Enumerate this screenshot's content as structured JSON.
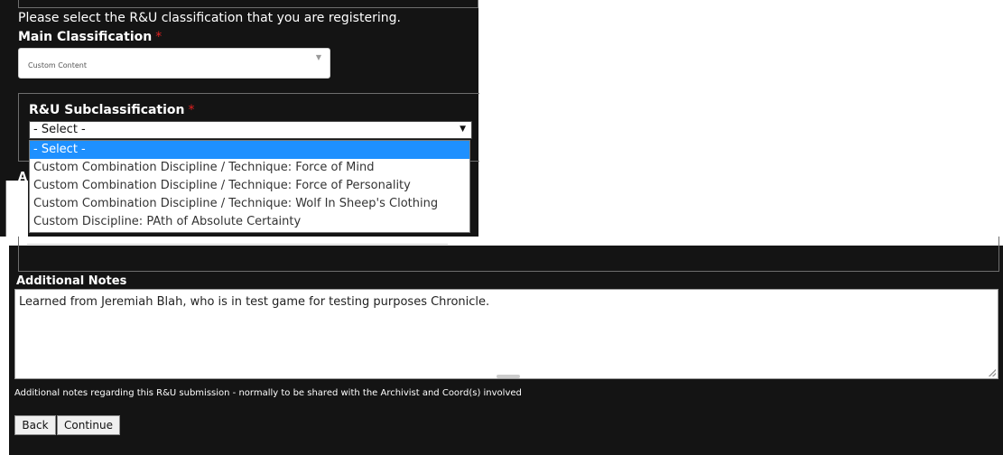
{
  "form": {
    "instructions": "Please select the R&U classification that you are registering.",
    "main_classification": {
      "label": "Main Classification",
      "required_marker": "*",
      "selected": "Custom Content"
    },
    "subclassification": {
      "label": "R&U Subclassification",
      "required_marker": "*",
      "selected": "- Select -",
      "options": [
        "- Select -",
        "Custom Combination Discipline / Technique: Force of Mind",
        "Custom Combination Discipline / Technique: Force of Personality",
        "Custom Combination Discipline / Technique: Wolf In Sheep's Clothing",
        "Custom Discipline: PAth of Absolute Certainty"
      ]
    },
    "obscured_label_letter": "A",
    "additional_notes": {
      "label": "Additional Notes",
      "value": "Learned from Jeremiah Blah, who is in test game for testing purposes Chronicle.",
      "helper": "Additional notes regarding this R&U submission - normally to be shared with the Archivist and Coord(s) involved"
    },
    "buttons": {
      "back": "Back",
      "continue": "Continue"
    }
  }
}
